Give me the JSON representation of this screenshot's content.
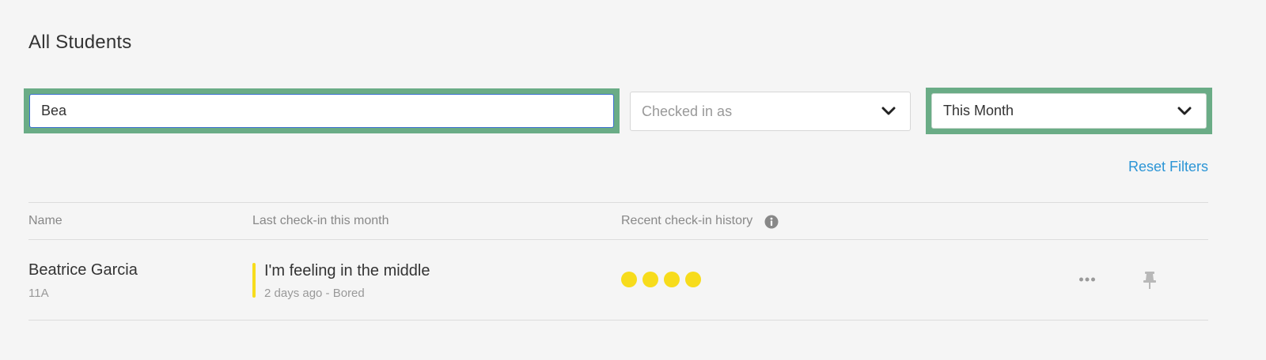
{
  "page": {
    "title": "All Students"
  },
  "filters": {
    "search_value": "Bea",
    "checked_in_placeholder": "Checked in as",
    "period_value": "This Month",
    "reset_label": "Reset Filters"
  },
  "table": {
    "headers": [
      "Name",
      "Last check-in this month",
      "Recent check-in history"
    ],
    "rows": [
      {
        "name": "Beatrice Garcia",
        "class": "11A",
        "last_checkin": "I'm feeling in the middle",
        "last_checkin_detail": "2 days ago - Bored",
        "history_count": 4
      }
    ]
  },
  "colors": {
    "accent_link": "#2b95d6",
    "focus_outline": "#6aac86",
    "mood_middle": "#f7dc1c"
  },
  "icons": [
    "info-icon",
    "chevron-down-icon",
    "more-icon",
    "pin-icon"
  ]
}
